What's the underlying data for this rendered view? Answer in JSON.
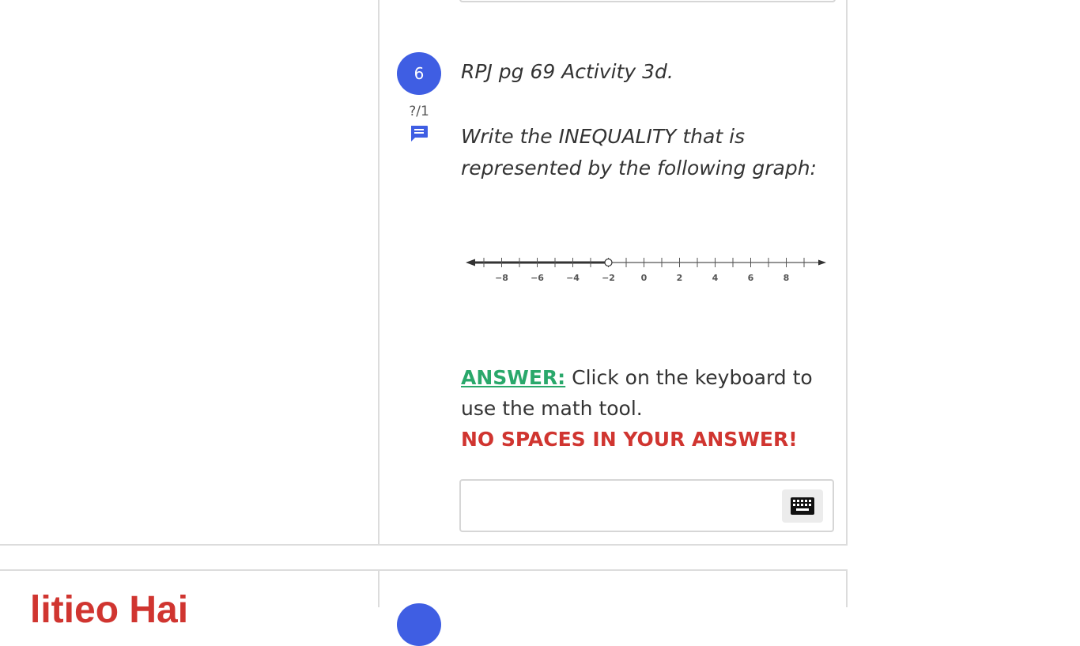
{
  "question": {
    "number": "6",
    "points": "?/1",
    "title": "RPJ pg 69 Activity 3d.",
    "prompt": "Write the INEQUALITY that  is represented by the following graph:",
    "answer_label": "ANSWER:",
    "answer_text": " Click on the keyboard to use the math tool.",
    "warning": "NO SPACES IN YOUR ANSWER!",
    "answer_value": ""
  },
  "number_line": {
    "tick_labels": [
      "−8",
      "−6",
      "−4",
      "−2",
      "0",
      "2",
      "4",
      "6",
      "8"
    ],
    "range": [
      -9,
      9
    ],
    "open_circle_at": -2,
    "shaded_direction": "left"
  },
  "next_section": {
    "heading": "litieo Hai"
  },
  "colors": {
    "accent_blue": "#3f5ee3",
    "answer_green": "#2aa86b",
    "warning_red": "#d03530"
  },
  "icons": {
    "comment": "comment-icon",
    "keyboard": "keyboard-icon"
  }
}
